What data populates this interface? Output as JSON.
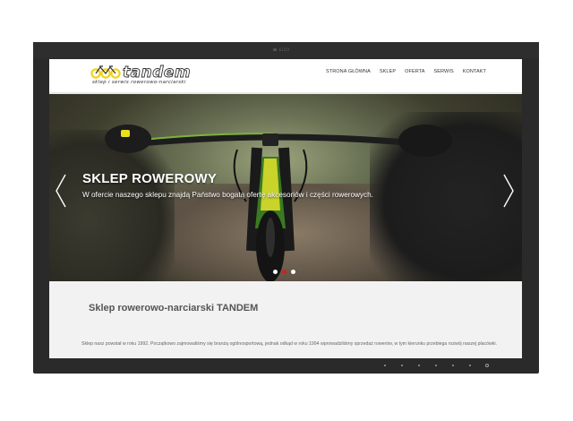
{
  "monitor": {
    "brand": "EIZO"
  },
  "site": {
    "logo_word": "tandem",
    "logo_tagline": "sklep i serwis rowerowo-narciarski"
  },
  "nav": [
    {
      "label": "STRONA GŁÓWNA"
    },
    {
      "label": "SKLEP"
    },
    {
      "label": "OFERTA"
    },
    {
      "label": "SERWIS"
    },
    {
      "label": "KONTAKT"
    }
  ],
  "slider": {
    "title": "SKLEP ROWEROWY",
    "text": "W ofercie naszego sklepu znajdą Państwo bogatą ofertę akcesoriów i części rowerowych.",
    "dots": [
      {
        "active": false
      },
      {
        "active": true
      },
      {
        "active": false
      }
    ]
  },
  "content": {
    "title": "Sklep rowerowo-narciarski TANDEM",
    "text": "Sklep nasz powstał w roku 1992. Początkowo zajmowaliśmy się branżą ogólnosportową, jednak odkąd w roku 1994 wprowadziliśmy sprzedaż rowerów, w tym kierunku przebiega rozwój naszej placówki."
  },
  "colors": {
    "accent": "#d42020",
    "logo_yellow": "#f2d21a"
  }
}
